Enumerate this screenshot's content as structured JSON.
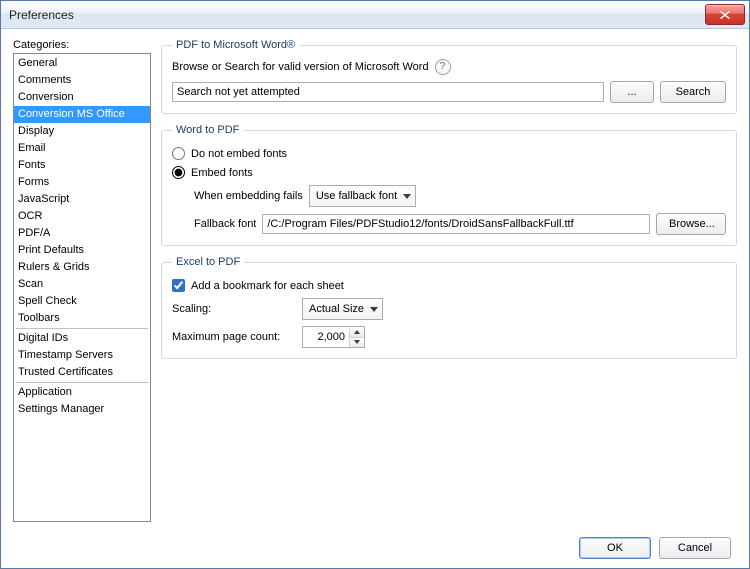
{
  "window": {
    "title": "Preferences"
  },
  "sidebar": {
    "label": "Categories:",
    "groups": [
      [
        "General",
        "Comments",
        "Conversion",
        "Conversion MS Office",
        "Display",
        "Email",
        "Fonts",
        "Forms",
        "JavaScript",
        "OCR",
        "PDF/A",
        "Print Defaults",
        "Rulers & Grids",
        "Scan",
        "Spell Check",
        "Toolbars"
      ],
      [
        "Digital IDs",
        "Timestamp Servers",
        "Trusted Certificates"
      ],
      [
        "Application",
        "Settings Manager"
      ]
    ],
    "selected": "Conversion MS Office"
  },
  "pdf2word": {
    "legend": "PDF to Microsoft Word®",
    "hint_label": "Browse or Search for valid version of Microsoft Word",
    "status_value": "Search not yet attempted",
    "browse_label": "...",
    "search_label": "Search"
  },
  "word2pdf": {
    "legend": "Word to PDF",
    "opt_no_embed": "Do not embed fonts",
    "opt_embed": "Embed fonts",
    "embed_selected": true,
    "when_fail_label": "When embedding fails",
    "when_fail_value": "Use fallback font",
    "fallback_label": "Fallback font",
    "fallback_value": "/C:/Program Files/PDFStudio12/fonts/DroidSansFallbackFull.ttf",
    "browse_label": "Browse..."
  },
  "excel2pdf": {
    "legend": "Excel to PDF",
    "bookmark_label": "Add a bookmark for each sheet",
    "bookmark_checked": true,
    "scaling_label": "Scaling:",
    "scaling_value": "Actual Size",
    "max_pages_label": "Maximum page count:",
    "max_pages_value": "2,000"
  },
  "footer": {
    "ok": "OK",
    "cancel": "Cancel"
  }
}
